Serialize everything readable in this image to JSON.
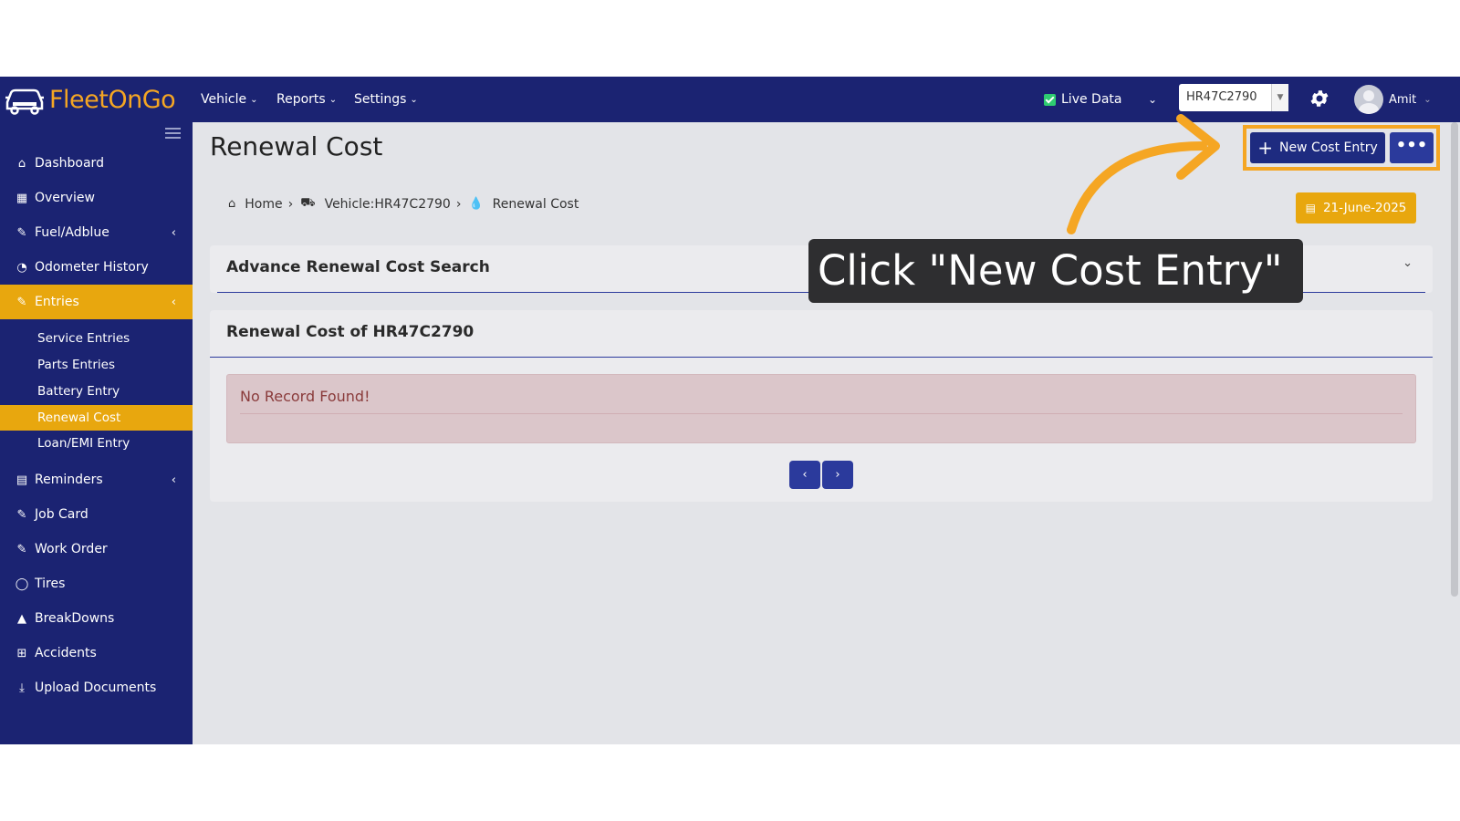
{
  "app": {
    "brand": "FleetOnGo"
  },
  "topnav": {
    "items": [
      {
        "label": "Vehicle"
      },
      {
        "label": "Reports"
      },
      {
        "label": "Settings"
      }
    ],
    "live_data": "Live Data",
    "vehicle_select": "HR47C2790",
    "user": "Amit"
  },
  "sidebar": {
    "items": [
      {
        "label": "Dashboard",
        "icon": "home-icon"
      },
      {
        "label": "Overview",
        "icon": "grid-icon"
      },
      {
        "label": "Fuel/Adblue",
        "icon": "edit-icon"
      },
      {
        "label": "Odometer History",
        "icon": "gauge-icon"
      },
      {
        "label": "Entries",
        "icon": "edit-icon"
      },
      {
        "label": "Reminders",
        "icon": "calendar-icon"
      },
      {
        "label": "Job Card",
        "icon": "edit-icon"
      },
      {
        "label": "Work Order",
        "icon": "edit-icon"
      },
      {
        "label": "Tires",
        "icon": "circle-icon"
      },
      {
        "label": "BreakDowns",
        "icon": "warning-icon"
      },
      {
        "label": "Accidents",
        "icon": "plus-square-icon"
      },
      {
        "label": "Upload Documents",
        "icon": "download-icon"
      }
    ],
    "entries_sub": [
      {
        "label": "Service Entries"
      },
      {
        "label": "Parts Entries"
      },
      {
        "label": "Battery Entry"
      },
      {
        "label": "Renewal Cost"
      },
      {
        "label": "Loan/EMI Entry"
      }
    ]
  },
  "page": {
    "title": "Renewal Cost",
    "new_button": "New Cost Entry",
    "breadcrumb": {
      "home": "Home",
      "vehicle": "Vehicle:HR47C2790",
      "current": "Renewal Cost"
    },
    "date": "21-June-2025",
    "search_title": "Advance Renewal Cost Search",
    "list_title": "Renewal Cost of HR47C2790",
    "empty_message": "No Record Found!"
  },
  "overlay": {
    "instruction": "Click \"New Cost Entry\""
  },
  "colors": {
    "nav_bg": "#1b2372",
    "accent": "#e8a70e",
    "button_primary": "#2b3a9c",
    "highlight": "#f5a623"
  }
}
